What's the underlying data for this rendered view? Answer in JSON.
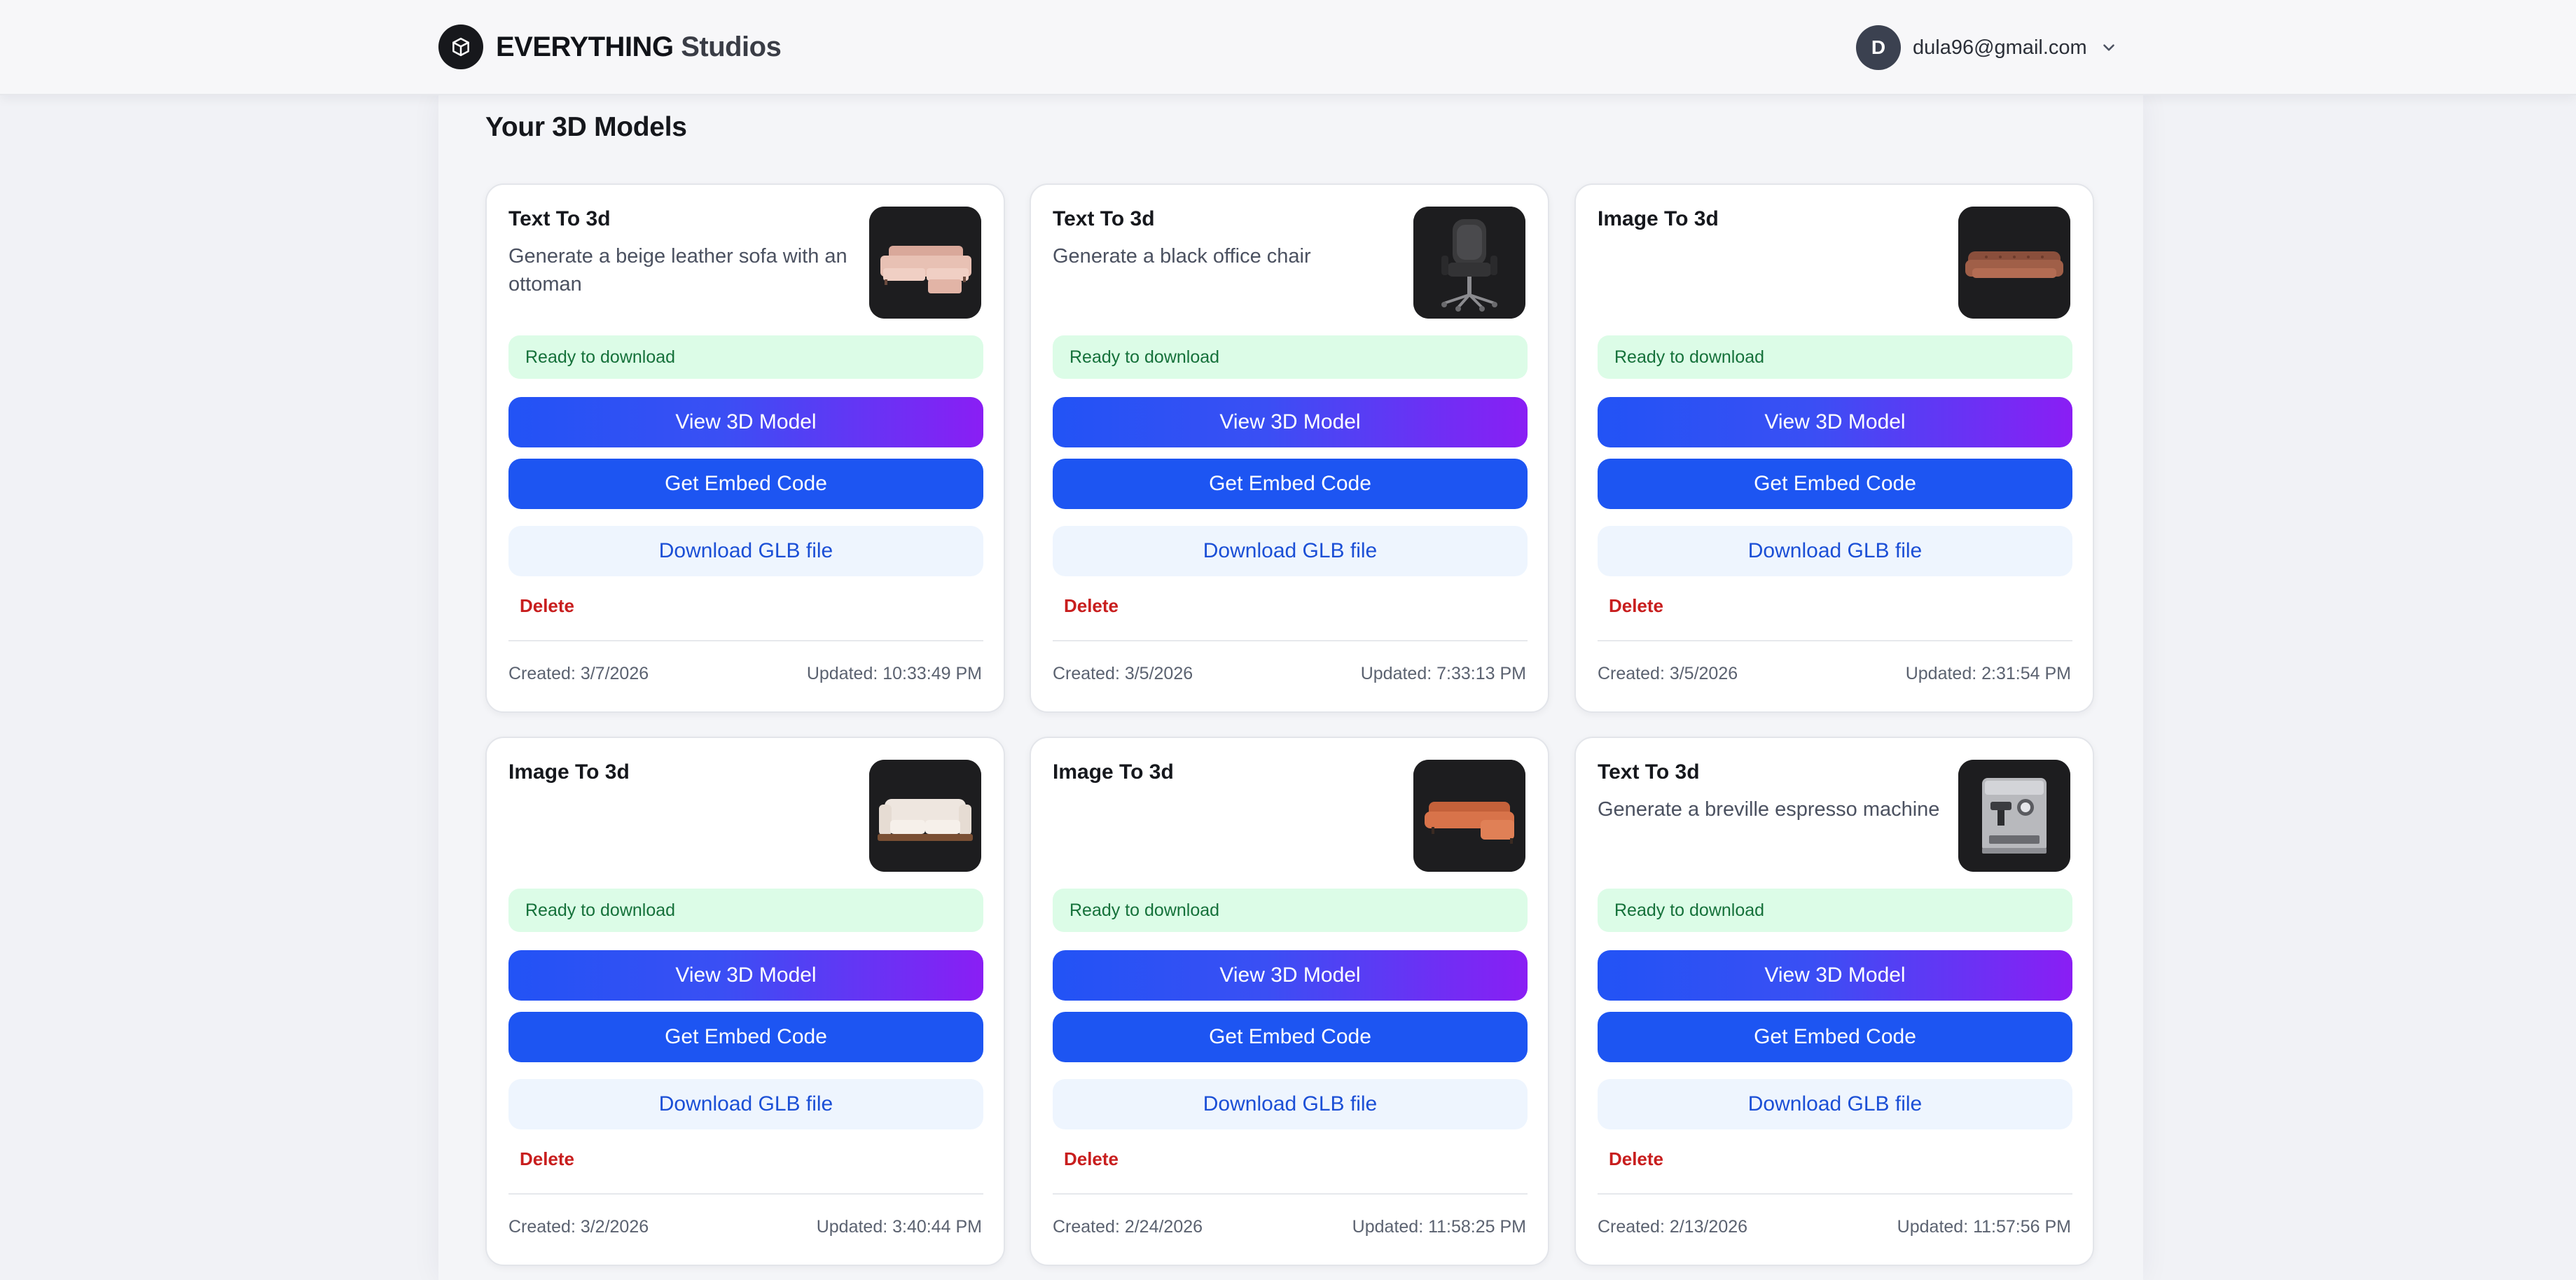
{
  "header": {
    "brand_strong": "EVERYTHING",
    "brand_light": "Studios",
    "user_initial": "D",
    "user_email": "dula96@gmail.com"
  },
  "main": {
    "title": "Your 3D Models"
  },
  "labels": {
    "status": "Ready to download",
    "view": "View 3D Model",
    "embed": "Get Embed Code",
    "download": "Download GLB file",
    "delete": "Delete"
  },
  "colors": {
    "brand_dark": "#17181c",
    "accent_blue": "#1d55f2",
    "gradient_end": "#8a1ef4",
    "status_bg": "#dcfce7",
    "status_text": "#15713a",
    "delete_red": "#c81e1e"
  },
  "models": [
    {
      "kind": "Text To 3d",
      "prompt": "Generate a beige leather sofa with an ottoman",
      "thumbnail": "beige-sectional-sofa-with-ottoman",
      "created": "Created: 3/7/2026",
      "updated": "Updated: 10:33:49 PM"
    },
    {
      "kind": "Text To 3d",
      "prompt": "Generate a black office chair",
      "thumbnail": "black-office-chair",
      "created": "Created: 3/5/2026",
      "updated": "Updated: 7:33:13 PM"
    },
    {
      "kind": "Image To 3d",
      "prompt": "",
      "thumbnail": "brown-chesterfield-sofa",
      "created": "Created: 3/5/2026",
      "updated": "Updated: 2:31:54 PM"
    },
    {
      "kind": "Image To 3d",
      "prompt": "",
      "thumbnail": "white-sofa-wood-base",
      "created": "Created: 3/2/2026",
      "updated": "Updated: 3:40:44 PM"
    },
    {
      "kind": "Image To 3d",
      "prompt": "",
      "thumbnail": "orange-leather-sectional",
      "created": "Created: 2/24/2026",
      "updated": "Updated: 11:58:25 PM"
    },
    {
      "kind": "Text To 3d",
      "prompt": "Generate a breville espresso machine",
      "thumbnail": "espresso-machine",
      "created": "Created: 2/13/2026",
      "updated": "Updated: 11:57:56 PM"
    }
  ]
}
